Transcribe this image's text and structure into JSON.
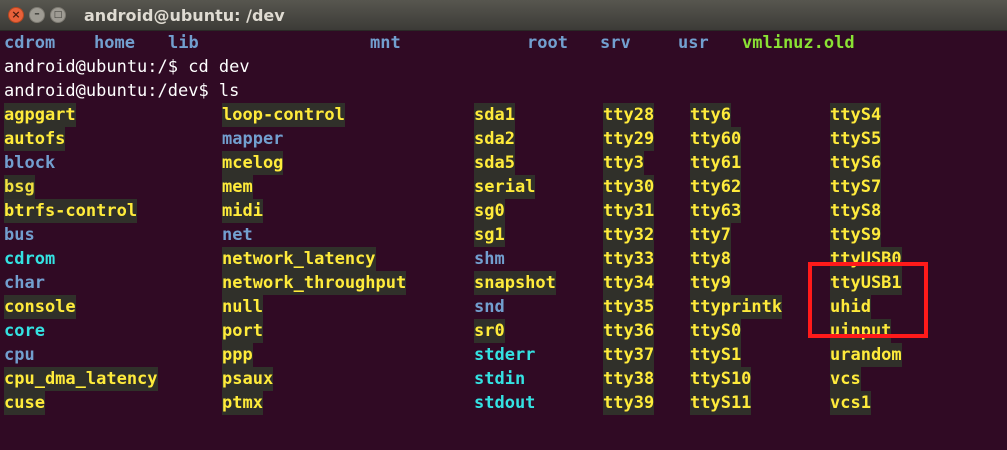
{
  "window": {
    "title": "android@ubuntu: /dev",
    "buttons": {
      "close": "×",
      "minimize": "–",
      "maximize": "□"
    }
  },
  "terminal": {
    "top_row": [
      "cdrom",
      "home",
      "lib",
      "mnt",
      "root",
      "srv",
      "usr",
      "vmlinuz.old"
    ],
    "prompt1": "android@ubuntu:/$ cd dev",
    "prompt2": "android@ubuntu:/dev$ ls",
    "columns": [
      [
        "agpgart",
        "autofs",
        "block",
        "bsg",
        "btrfs-control",
        "bus",
        "cdrom",
        "char",
        "console",
        "core",
        "cpu",
        "cpu_dma_latency",
        "cuse"
      ],
      [
        "loop-control",
        "mapper",
        "mcelog",
        "mem",
        "midi",
        "net",
        "network_latency",
        "network_throughput",
        "null",
        "port",
        "ppp",
        "psaux",
        "ptmx"
      ],
      [
        "sda1",
        "sda2",
        "sda5",
        "serial",
        "sg0",
        "sg1",
        "shm",
        "snapshot",
        "snd",
        "sr0",
        "stderr",
        "stdin",
        "stdout"
      ],
      [
        "tty28",
        "tty29",
        "tty3",
        "tty30",
        "tty31",
        "tty32",
        "tty33",
        "tty34",
        "tty35",
        "tty36",
        "tty37",
        "tty38",
        "tty39"
      ],
      [
        "tty6",
        "tty60",
        "tty61",
        "tty62",
        "tty63",
        "tty7",
        "tty8",
        "tty9",
        "ttyprintk",
        "ttyS0",
        "ttyS1",
        "ttyS10",
        "ttyS11"
      ],
      [
        "ttyS4",
        "ttyS5",
        "ttyS6",
        "ttyS7",
        "ttyS8",
        "ttyS9",
        "ttyUSB0",
        "ttyUSB1",
        "uhid",
        "uinput",
        "urandom",
        "vcs",
        "vcs1"
      ]
    ]
  },
  "colors": {
    "terminal_bg": "#300a24",
    "directory": "#729fcf",
    "device": "#ffeb3b",
    "device_bg": "#30302a",
    "highlight_box": "#ff1a1a"
  }
}
